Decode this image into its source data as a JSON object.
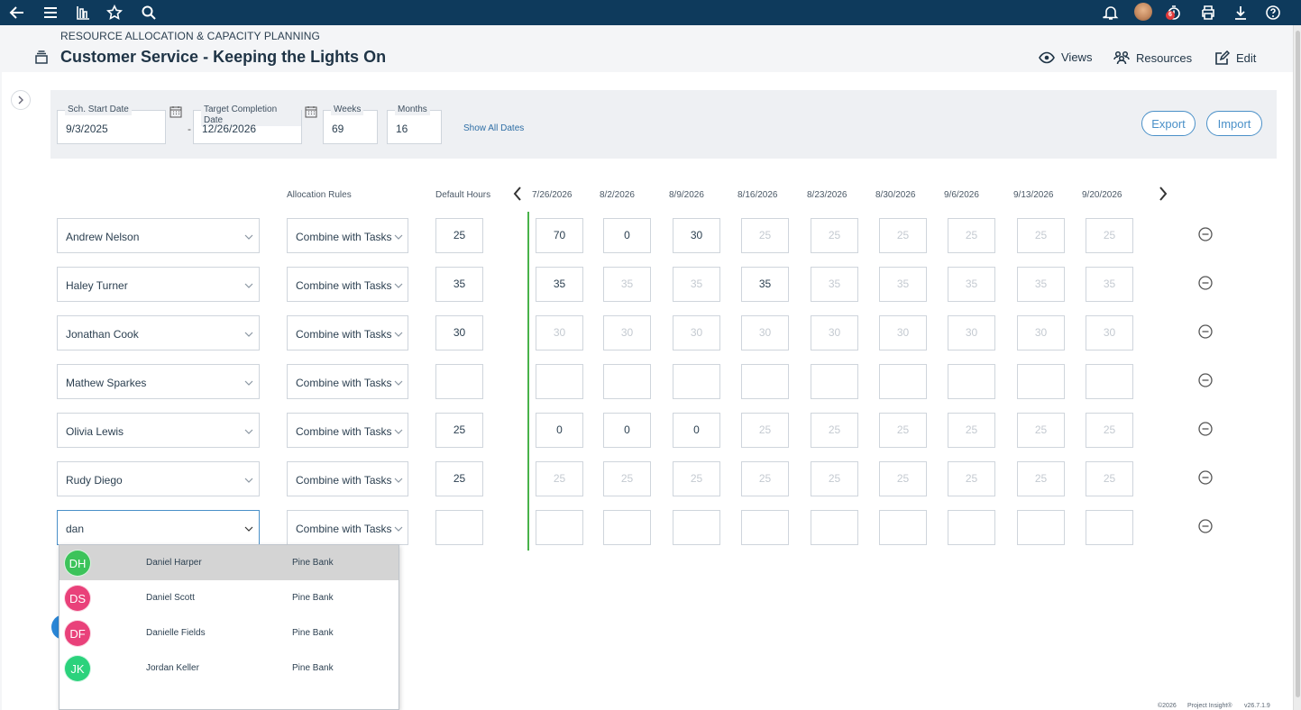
{
  "topbar": {
    "icons": [
      "back-arrow-icon",
      "menu-icon",
      "reports-icon",
      "star-icon",
      "search-icon",
      "bell-icon",
      "user-avatar",
      "timer-icon",
      "print-icon",
      "download-icon",
      "help-icon"
    ],
    "timer_badge": "6"
  },
  "header": {
    "breadcrumb": "RESOURCE ALLOCATION & CAPACITY PLANNING",
    "title": "Customer Service - Keeping the Lights On",
    "actions": {
      "views": "Views",
      "resources": "Resources",
      "edit": "Edit"
    }
  },
  "dates": {
    "start": {
      "label": "Sch. Start Date",
      "value": "9/3/2025"
    },
    "target": {
      "label": "Target Completion Date",
      "value": "12/26/2026"
    },
    "weeks": {
      "label": "Weeks",
      "value": "69"
    },
    "months": {
      "label": "Months",
      "value": "16"
    },
    "dash": "-",
    "show_all": "Show All Dates",
    "export": "Export",
    "import": "Import"
  },
  "grid": {
    "allocation_rules_header": "Allocation Rules",
    "default_hours_header": "Default Hours",
    "weeks": [
      "7/26/2026",
      "8/2/2026",
      "8/9/2026",
      "8/16/2026",
      "8/23/2026",
      "8/30/2026",
      "9/6/2026",
      "9/13/2026",
      "9/20/2026"
    ],
    "rows": [
      {
        "name": "Andrew Nelson",
        "rule": "Combine with Tasks",
        "default": "25",
        "cells": [
          [
            "70",
            0
          ],
          [
            "0",
            0
          ],
          [
            "30",
            0
          ],
          [
            "25",
            1
          ],
          [
            "25",
            1
          ],
          [
            "25",
            1
          ],
          [
            "25",
            1
          ],
          [
            "25",
            1
          ],
          [
            "25",
            1
          ]
        ]
      },
      {
        "name": "Haley Turner",
        "rule": "Combine with Tasks",
        "default": "35",
        "cells": [
          [
            "35",
            0
          ],
          [
            "35",
            1
          ],
          [
            "35",
            1
          ],
          [
            "35",
            0
          ],
          [
            "35",
            1
          ],
          [
            "35",
            1
          ],
          [
            "35",
            1
          ],
          [
            "35",
            1
          ],
          [
            "35",
            1
          ]
        ]
      },
      {
        "name": "Jonathan Cook",
        "rule": "Combine with Tasks",
        "default": "30",
        "cells": [
          [
            "30",
            1
          ],
          [
            "30",
            1
          ],
          [
            "30",
            1
          ],
          [
            "30",
            1
          ],
          [
            "30",
            1
          ],
          [
            "30",
            1
          ],
          [
            "30",
            1
          ],
          [
            "30",
            1
          ],
          [
            "30",
            1
          ]
        ]
      },
      {
        "name": "Mathew Sparkes",
        "rule": "Combine with Tasks",
        "default": "",
        "cells": [
          [
            "",
            0
          ],
          [
            "",
            0
          ],
          [
            "",
            0
          ],
          [
            "",
            0
          ],
          [
            "",
            0
          ],
          [
            "",
            0
          ],
          [
            "",
            0
          ],
          [
            "",
            0
          ],
          [
            "",
            0
          ]
        ]
      },
      {
        "name": "Olivia Lewis",
        "rule": "Combine with Tasks",
        "default": "25",
        "cells": [
          [
            "0",
            0
          ],
          [
            "0",
            0
          ],
          [
            "0",
            0
          ],
          [
            "25",
            1
          ],
          [
            "25",
            1
          ],
          [
            "25",
            1
          ],
          [
            "25",
            1
          ],
          [
            "25",
            1
          ],
          [
            "25",
            1
          ]
        ]
      },
      {
        "name": "Rudy Diego",
        "rule": "Combine with Tasks",
        "default": "25",
        "cells": [
          [
            "25",
            1
          ],
          [
            "25",
            1
          ],
          [
            "25",
            1
          ],
          [
            "25",
            1
          ],
          [
            "25",
            1
          ],
          [
            "25",
            1
          ],
          [
            "25",
            1
          ],
          [
            "25",
            1
          ],
          [
            "25",
            1
          ]
        ]
      },
      {
        "name": "dan",
        "rule": "Combine with Tasks",
        "default": "",
        "cells": [
          [
            "",
            0
          ],
          [
            "",
            0
          ],
          [
            "",
            0
          ],
          [
            "",
            0
          ],
          [
            "",
            0
          ],
          [
            "",
            0
          ],
          [
            "",
            0
          ],
          [
            "",
            0
          ],
          [
            "",
            0
          ]
        ]
      }
    ]
  },
  "dropdown": {
    "items": [
      {
        "initials": "DH",
        "name": "Daniel Harper",
        "org": "Pine Bank",
        "color": "#3cc35a",
        "highlighted": true
      },
      {
        "initials": "DS",
        "name": "Daniel Scott",
        "org": "Pine Bank",
        "color": "#e9417a",
        "highlighted": false
      },
      {
        "initials": "DF",
        "name": "Danielle Fields",
        "org": "Pine Bank",
        "color": "#e9417a",
        "highlighted": false
      },
      {
        "initials": "JK",
        "name": "Jordan Keller",
        "org": "Pine Bank",
        "color": "#2bd27c",
        "highlighted": false
      }
    ]
  },
  "footer": {
    "copyright": "©2026",
    "product": "Project Insight®",
    "version": "v26.7.1.9"
  }
}
